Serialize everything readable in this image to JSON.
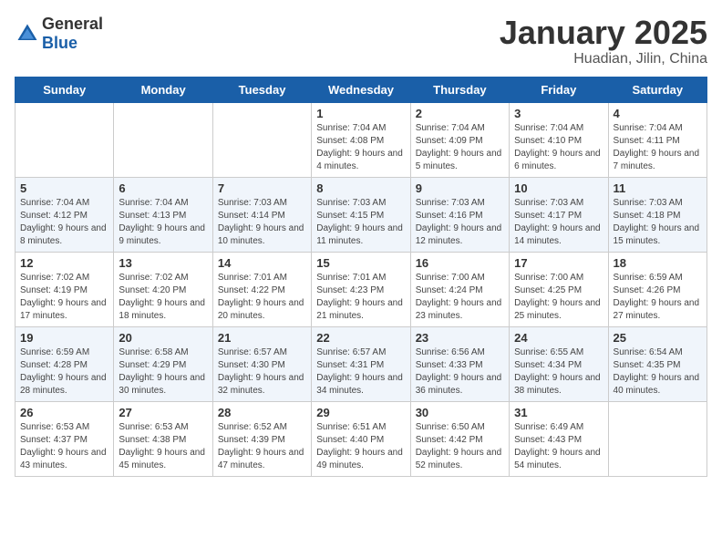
{
  "header": {
    "logo_general": "General",
    "logo_blue": "Blue",
    "month": "January 2025",
    "location": "Huadian, Jilin, China"
  },
  "days_of_week": [
    "Sunday",
    "Monday",
    "Tuesday",
    "Wednesday",
    "Thursday",
    "Friday",
    "Saturday"
  ],
  "weeks": [
    {
      "cells": [
        {
          "day": "",
          "info": ""
        },
        {
          "day": "",
          "info": ""
        },
        {
          "day": "",
          "info": ""
        },
        {
          "day": "1",
          "info": "Sunrise: 7:04 AM\nSunset: 4:08 PM\nDaylight: 9 hours and 4 minutes."
        },
        {
          "day": "2",
          "info": "Sunrise: 7:04 AM\nSunset: 4:09 PM\nDaylight: 9 hours and 5 minutes."
        },
        {
          "day": "3",
          "info": "Sunrise: 7:04 AM\nSunset: 4:10 PM\nDaylight: 9 hours and 6 minutes."
        },
        {
          "day": "4",
          "info": "Sunrise: 7:04 AM\nSunset: 4:11 PM\nDaylight: 9 hours and 7 minutes."
        }
      ]
    },
    {
      "cells": [
        {
          "day": "5",
          "info": "Sunrise: 7:04 AM\nSunset: 4:12 PM\nDaylight: 9 hours and 8 minutes."
        },
        {
          "day": "6",
          "info": "Sunrise: 7:04 AM\nSunset: 4:13 PM\nDaylight: 9 hours and 9 minutes."
        },
        {
          "day": "7",
          "info": "Sunrise: 7:03 AM\nSunset: 4:14 PM\nDaylight: 9 hours and 10 minutes."
        },
        {
          "day": "8",
          "info": "Sunrise: 7:03 AM\nSunset: 4:15 PM\nDaylight: 9 hours and 11 minutes."
        },
        {
          "day": "9",
          "info": "Sunrise: 7:03 AM\nSunset: 4:16 PM\nDaylight: 9 hours and 12 minutes."
        },
        {
          "day": "10",
          "info": "Sunrise: 7:03 AM\nSunset: 4:17 PM\nDaylight: 9 hours and 14 minutes."
        },
        {
          "day": "11",
          "info": "Sunrise: 7:03 AM\nSunset: 4:18 PM\nDaylight: 9 hours and 15 minutes."
        }
      ]
    },
    {
      "cells": [
        {
          "day": "12",
          "info": "Sunrise: 7:02 AM\nSunset: 4:19 PM\nDaylight: 9 hours and 17 minutes."
        },
        {
          "day": "13",
          "info": "Sunrise: 7:02 AM\nSunset: 4:20 PM\nDaylight: 9 hours and 18 minutes."
        },
        {
          "day": "14",
          "info": "Sunrise: 7:01 AM\nSunset: 4:22 PM\nDaylight: 9 hours and 20 minutes."
        },
        {
          "day": "15",
          "info": "Sunrise: 7:01 AM\nSunset: 4:23 PM\nDaylight: 9 hours and 21 minutes."
        },
        {
          "day": "16",
          "info": "Sunrise: 7:00 AM\nSunset: 4:24 PM\nDaylight: 9 hours and 23 minutes."
        },
        {
          "day": "17",
          "info": "Sunrise: 7:00 AM\nSunset: 4:25 PM\nDaylight: 9 hours and 25 minutes."
        },
        {
          "day": "18",
          "info": "Sunrise: 6:59 AM\nSunset: 4:26 PM\nDaylight: 9 hours and 27 minutes."
        }
      ]
    },
    {
      "cells": [
        {
          "day": "19",
          "info": "Sunrise: 6:59 AM\nSunset: 4:28 PM\nDaylight: 9 hours and 28 minutes."
        },
        {
          "day": "20",
          "info": "Sunrise: 6:58 AM\nSunset: 4:29 PM\nDaylight: 9 hours and 30 minutes."
        },
        {
          "day": "21",
          "info": "Sunrise: 6:57 AM\nSunset: 4:30 PM\nDaylight: 9 hours and 32 minutes."
        },
        {
          "day": "22",
          "info": "Sunrise: 6:57 AM\nSunset: 4:31 PM\nDaylight: 9 hours and 34 minutes."
        },
        {
          "day": "23",
          "info": "Sunrise: 6:56 AM\nSunset: 4:33 PM\nDaylight: 9 hours and 36 minutes."
        },
        {
          "day": "24",
          "info": "Sunrise: 6:55 AM\nSunset: 4:34 PM\nDaylight: 9 hours and 38 minutes."
        },
        {
          "day": "25",
          "info": "Sunrise: 6:54 AM\nSunset: 4:35 PM\nDaylight: 9 hours and 40 minutes."
        }
      ]
    },
    {
      "cells": [
        {
          "day": "26",
          "info": "Sunrise: 6:53 AM\nSunset: 4:37 PM\nDaylight: 9 hours and 43 minutes."
        },
        {
          "day": "27",
          "info": "Sunrise: 6:53 AM\nSunset: 4:38 PM\nDaylight: 9 hours and 45 minutes."
        },
        {
          "day": "28",
          "info": "Sunrise: 6:52 AM\nSunset: 4:39 PM\nDaylight: 9 hours and 47 minutes."
        },
        {
          "day": "29",
          "info": "Sunrise: 6:51 AM\nSunset: 4:40 PM\nDaylight: 9 hours and 49 minutes."
        },
        {
          "day": "30",
          "info": "Sunrise: 6:50 AM\nSunset: 4:42 PM\nDaylight: 9 hours and 52 minutes."
        },
        {
          "day": "31",
          "info": "Sunrise: 6:49 AM\nSunset: 4:43 PM\nDaylight: 9 hours and 54 minutes."
        },
        {
          "day": "",
          "info": ""
        }
      ]
    }
  ]
}
